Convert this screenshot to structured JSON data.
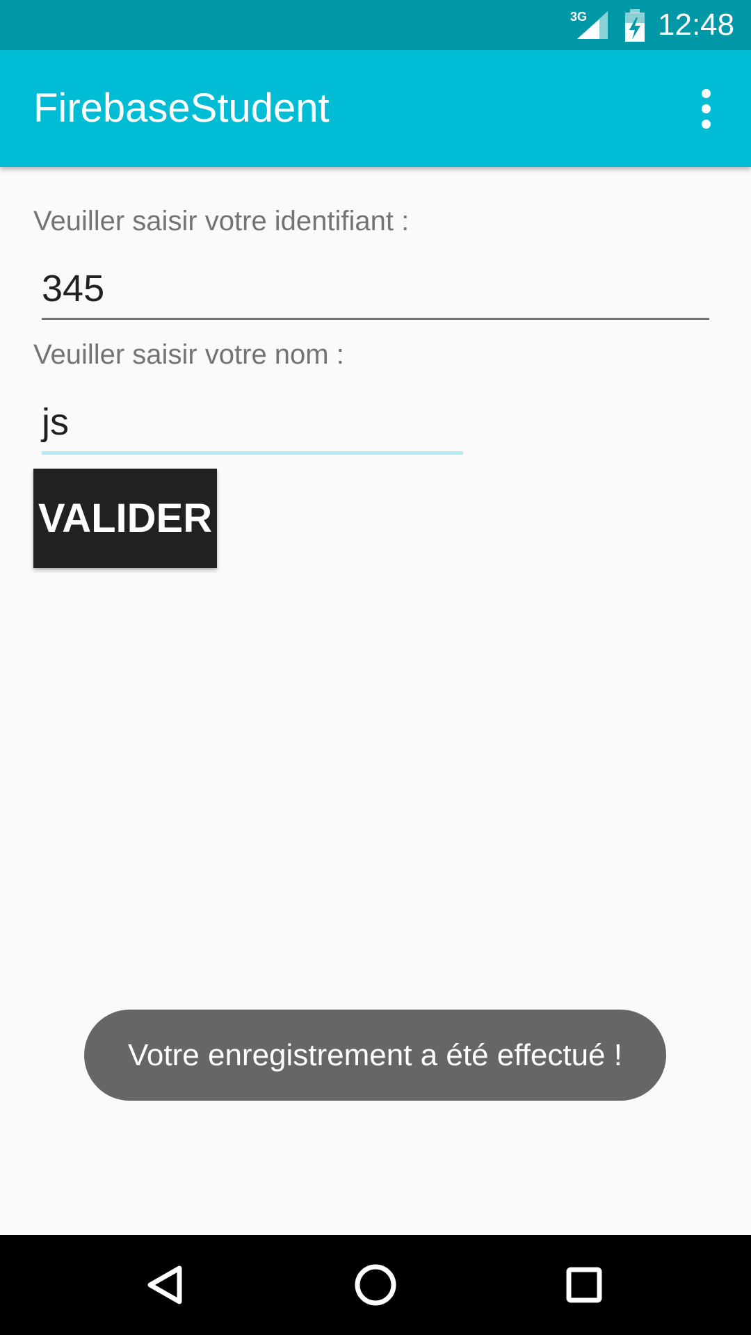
{
  "status_bar": {
    "network_label": "3G",
    "time": "12:48",
    "icons": [
      "signal-3g-icon",
      "battery-charging-icon"
    ],
    "background_color": "#0097a7"
  },
  "app_bar": {
    "title": "FirebaseStudent",
    "menu_icon": "more-vert-icon",
    "background_color": "#00bcd4"
  },
  "form": {
    "id_label": "Veuiller saisir votre identifiant :",
    "id_value": "345",
    "name_label": "Veuiller saisir votre nom :",
    "name_value": "js",
    "submit_label": "VALIDER"
  },
  "toast": {
    "message": "Votre enregistrement a été effectué !"
  },
  "nav_bar": {
    "icons": [
      "back-icon",
      "home-icon",
      "recents-icon"
    ]
  }
}
